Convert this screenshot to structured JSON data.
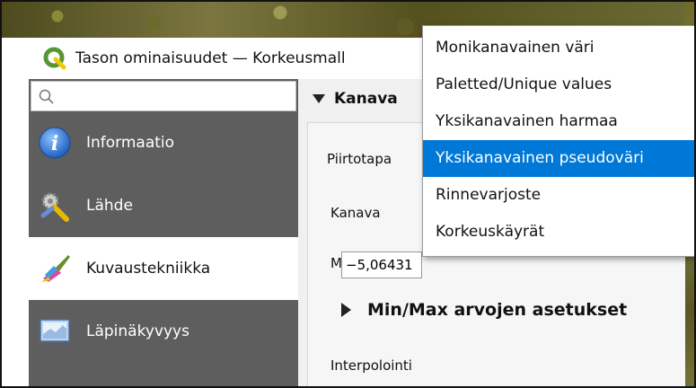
{
  "window": {
    "title": "Tason ominaisuudet — Korkeusmall"
  },
  "sidebar": {
    "search": {
      "placeholder": "",
      "icon": "search-icon"
    },
    "items": [
      {
        "label": "Informaatio",
        "icon": "info-icon",
        "active": false
      },
      {
        "label": "Lähde",
        "icon": "source-settings-icon",
        "active": false
      },
      {
        "label": "Kuvaustekniikka",
        "icon": "paintbrush-icon",
        "active": true
      },
      {
        "label": "Läpinäkyvyys",
        "icon": "transparency-icon",
        "active": false
      }
    ]
  },
  "main": {
    "section_title": "Kanava",
    "render_type_label": "Piirtotapa",
    "band_label": "Kanava",
    "min_label": "Min",
    "min_value": "−5,06431",
    "minmax_label": "Min/Max arvojen asetukset",
    "interpolation_label": "Interpolointi"
  },
  "dropdown": {
    "options": [
      "Monikanavainen väri",
      "Paletted/Unique values",
      "Yksikanavainen harmaa",
      "Yksikanavainen pseudoväri",
      "Rinnevarjoste",
      "Korkeuskäyrät"
    ],
    "selected_index": 3
  },
  "colors": {
    "selection": "#0078d7",
    "sidebar_bg": "#5e5e5e",
    "qgis_green": "#589632",
    "qgis_yellow": "#eec90d"
  }
}
